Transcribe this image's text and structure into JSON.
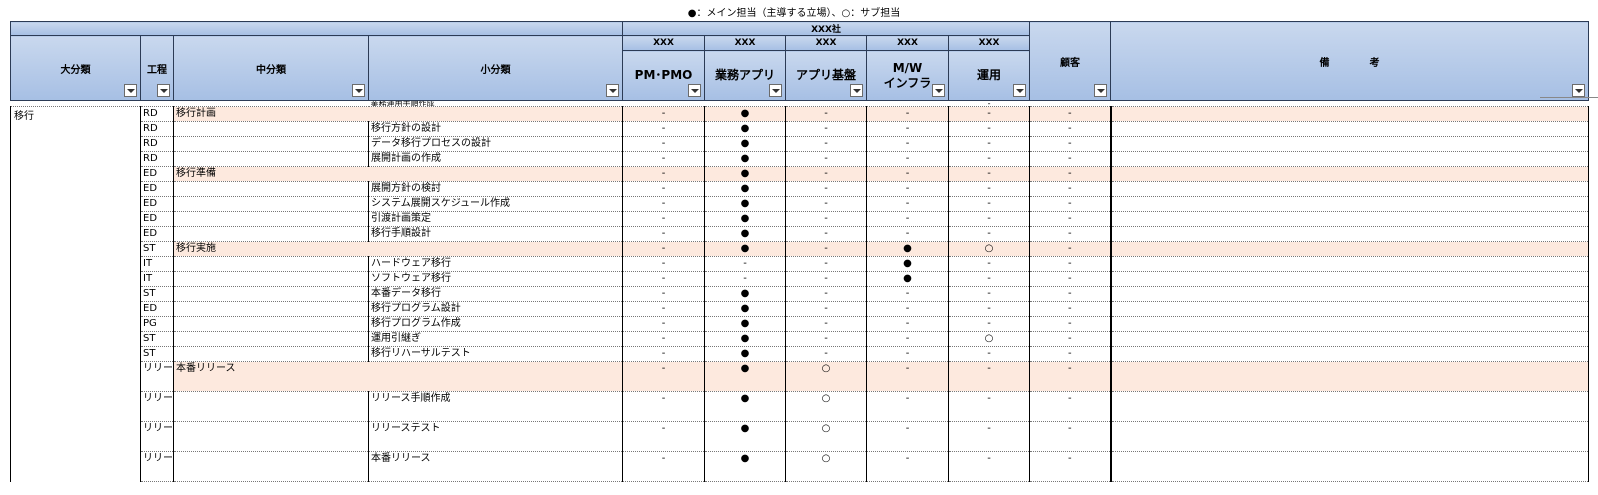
{
  "legend": "●：メイン担当（主導する立場）、○：サブ担当",
  "header": {
    "major": "大分類",
    "process": "工程",
    "middle": "中分類",
    "minor": "小分類",
    "company": "XXX社",
    "customer": "顧客",
    "notes": "備　　　　考",
    "roles": [
      {
        "org": "XXX",
        "name": "PM･PMO"
      },
      {
        "org": "XXX",
        "name": "業務アプリ"
      },
      {
        "org": "XXX",
        "name": "アプリ基盤"
      },
      {
        "org": "XXX",
        "name_line1": "M/W",
        "name_line2": "インフラ"
      },
      {
        "org": "XXX",
        "name": "運用"
      }
    ]
  },
  "partial_row": {
    "minor": "業務運用手順作成",
    "m4": "-"
  },
  "major_value": "移行",
  "rows": [
    {
      "type": "cat",
      "process": "RD",
      "middle": "移行計画",
      "minor": "",
      "m": [
        "-",
        "●",
        "-",
        "-",
        "-",
        "-"
      ]
    },
    {
      "type": "item",
      "process": "RD",
      "middle": "",
      "minor": "移行方針の設計",
      "m": [
        "-",
        "●",
        "-",
        "-",
        "-",
        "-"
      ]
    },
    {
      "type": "item",
      "process": "RD",
      "middle": "",
      "minor": "データ移行プロセスの設計",
      "m": [
        "-",
        "●",
        "-",
        "-",
        "-",
        "-"
      ]
    },
    {
      "type": "item",
      "process": "RD",
      "middle": "",
      "minor": "展開計画の作成",
      "m": [
        "-",
        "●",
        "-",
        "-",
        "-",
        "-"
      ]
    },
    {
      "type": "cat",
      "process": "ED",
      "middle": "移行準備",
      "minor": "",
      "m": [
        "-",
        "●",
        "-",
        "-",
        "-",
        "-"
      ]
    },
    {
      "type": "item",
      "process": "ED",
      "middle": "",
      "minor": "展開方針の検討",
      "m": [
        "-",
        "●",
        "-",
        "-",
        "-",
        "-"
      ]
    },
    {
      "type": "item",
      "process": "ED",
      "middle": "",
      "minor": "システム展開スケジュール作成",
      "m": [
        "-",
        "●",
        "-",
        "-",
        "-",
        "-"
      ]
    },
    {
      "type": "item",
      "process": "ED",
      "middle": "",
      "minor": "引渡計画策定",
      "m": [
        "-",
        "●",
        "-",
        "-",
        "-",
        "-"
      ]
    },
    {
      "type": "item",
      "process": "ED",
      "middle": "",
      "minor": "移行手順設計",
      "m": [
        "-",
        "●",
        "-",
        "-",
        "-",
        "-"
      ]
    },
    {
      "type": "cat",
      "process": "ST",
      "middle": "移行実施",
      "minor": "",
      "m": [
        "-",
        "●",
        "-",
        "●",
        "○",
        "-"
      ]
    },
    {
      "type": "item",
      "process": "IT",
      "middle": "",
      "minor": "ハードウェア移行",
      "m": [
        "-",
        "-",
        "-",
        "●",
        "-",
        "-"
      ]
    },
    {
      "type": "item",
      "process": "IT",
      "middle": "",
      "minor": "ソフトウェア移行",
      "m": [
        "-",
        "-",
        "-",
        "●",
        "-",
        "-"
      ]
    },
    {
      "type": "item",
      "process": "ST",
      "middle": "",
      "minor": "本番データ移行",
      "m": [
        "-",
        "●",
        "-",
        "-",
        "-",
        "-"
      ]
    },
    {
      "type": "item",
      "process": "ED",
      "middle": "",
      "minor": "移行プログラム設計",
      "m": [
        "-",
        "●",
        "-",
        "-",
        "-",
        "-"
      ]
    },
    {
      "type": "item",
      "process": "PG",
      "middle": "",
      "minor": "移行プログラム作成",
      "m": [
        "-",
        "●",
        "-",
        "-",
        "-",
        "-"
      ]
    },
    {
      "type": "item",
      "process": "ST",
      "middle": "",
      "minor": "運用引継ぎ",
      "m": [
        "-",
        "●",
        "-",
        "-",
        "○",
        "-"
      ]
    },
    {
      "type": "item",
      "process": "ST",
      "middle": "",
      "minor": "移行リハーサルテスト",
      "m": [
        "-",
        "●",
        "-",
        "-",
        "-",
        "-"
      ]
    },
    {
      "type": "cat-tall",
      "process": "リリース",
      "middle": "本番リリース",
      "minor": "",
      "m": [
        "-",
        "●",
        "○",
        "-",
        "-",
        "-"
      ]
    },
    {
      "type": "item-tall",
      "process": "リリース",
      "middle": "",
      "minor": "リリース手順作成",
      "m": [
        "-",
        "●",
        "○",
        "-",
        "-",
        "-"
      ]
    },
    {
      "type": "item-tall",
      "process": "リリース",
      "middle": "",
      "minor": "リリーステスト",
      "m": [
        "-",
        "●",
        "○",
        "-",
        "-",
        "-"
      ]
    },
    {
      "type": "item-tall",
      "process": "リリース",
      "middle": "",
      "minor": "本番リリース",
      "m": [
        "-",
        "●",
        "○",
        "-",
        "-",
        "-"
      ]
    }
  ]
}
